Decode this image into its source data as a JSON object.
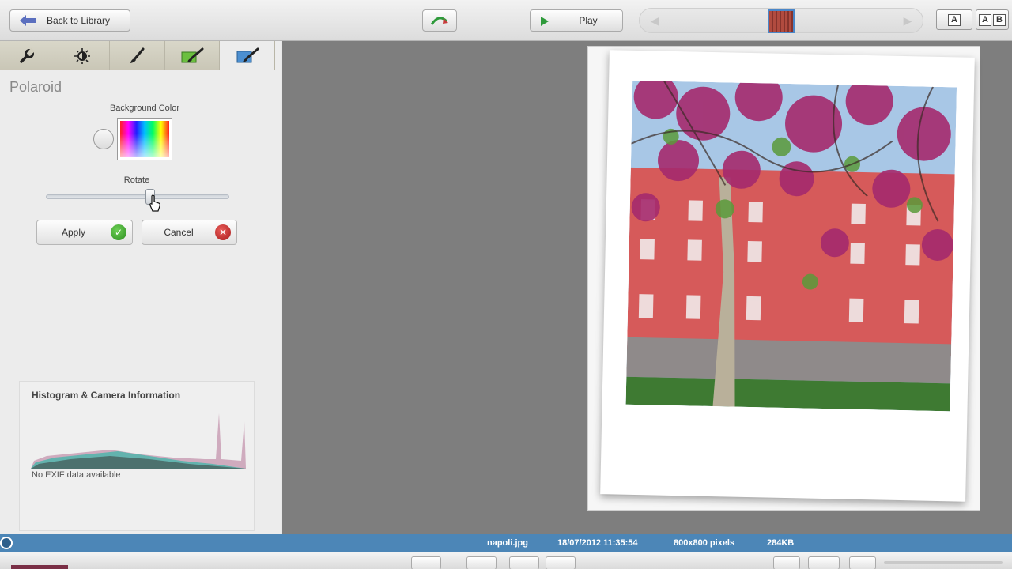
{
  "toolbar": {
    "back_label": "Back to Library",
    "play_label": "Play",
    "view_single": "A",
    "view_compare_a": "A",
    "view_compare_b": "B"
  },
  "panel": {
    "tabs": [
      {
        "name": "wrench-icon"
      },
      {
        "name": "brightness-icon"
      },
      {
        "name": "brush-icon"
      },
      {
        "name": "effects-icon"
      },
      {
        "name": "frame-icon",
        "active": true
      }
    ],
    "title": "Polaroid",
    "bgcolor_label": "Background Color",
    "rotate_label": "Rotate",
    "rotate_value": 0.57,
    "apply_label": "Apply",
    "cancel_label": "Cancel"
  },
  "histogram": {
    "title": "Histogram & Camera Information",
    "exif": "No EXIF data available"
  },
  "status": {
    "filename": "napoli.jpg",
    "date": "18/07/2012 11:35:54",
    "dimensions": "800x800 pixels",
    "size": "284KB"
  },
  "colors": {
    "accent": "#4c86b7",
    "apply_green": "#3aa32a",
    "cancel_red": "#c62828"
  }
}
